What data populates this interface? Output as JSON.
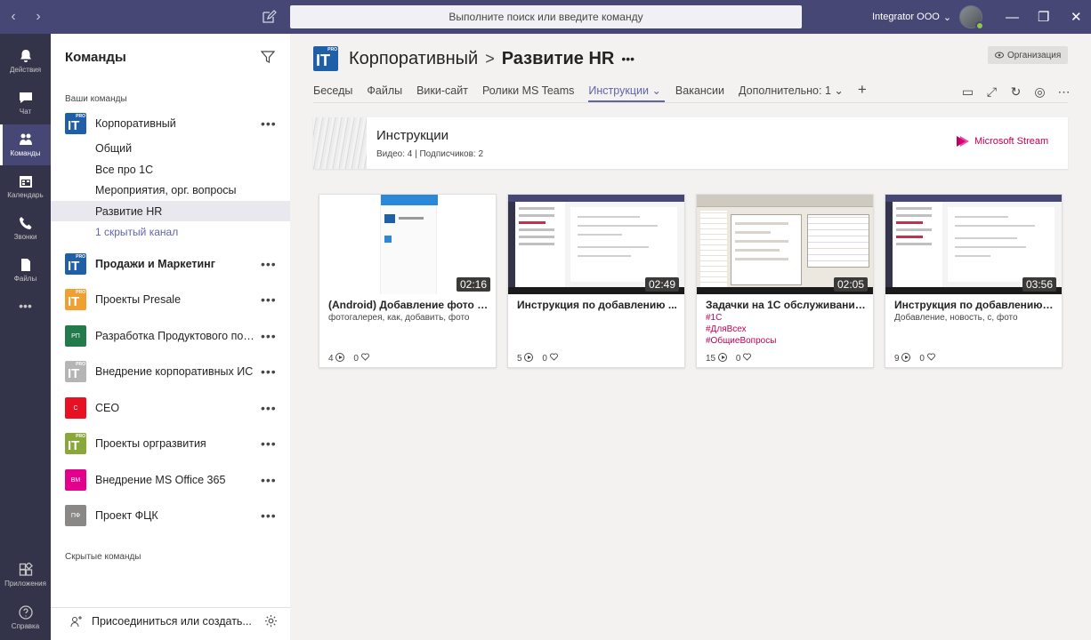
{
  "topbar": {
    "search_placeholder": "Выполните поиск или введите команду",
    "account_name": "Integrator OOO",
    "account_chevron": "⌄"
  },
  "rail": [
    {
      "label": "Действия",
      "icon": "bell-icon"
    },
    {
      "label": "Чат",
      "icon": "chat-icon"
    },
    {
      "label": "Команды",
      "icon": "teams-icon",
      "active": true
    },
    {
      "label": "Календарь",
      "icon": "calendar-icon"
    },
    {
      "label": "Звонки",
      "icon": "phone-icon"
    },
    {
      "label": "Файлы",
      "icon": "files-icon"
    },
    {
      "label": "•••",
      "icon": "more-icon"
    },
    {
      "label": "Приложения",
      "icon": "apps-icon"
    },
    {
      "label": "Справка",
      "icon": "help-icon"
    }
  ],
  "teams_panel": {
    "title": "Команды",
    "your_teams_label": "Ваши команды",
    "hidden_teams_label": "Скрытые команды",
    "join_label": "Присоединиться или создать...",
    "teams": [
      {
        "name": "Корпоративный",
        "logo": "IT",
        "logo_text": "",
        "color": "#1f5fa8",
        "bold": false
      },
      {
        "name": "Продажи и Маркетинг",
        "logo": "IT",
        "logo_text": "",
        "color": "#1f5fa8",
        "bold": true
      },
      {
        "name": "Проекты Presale",
        "logo": "IT-orange",
        "logo_text": "",
        "color": "#f0a030",
        "bold": false
      },
      {
        "name": "Разработка Продуктового пор...",
        "logo": "initials",
        "logo_text": "РП",
        "color": "#237b4b",
        "bold": false
      },
      {
        "name": "Внедрение корпоративных ИС",
        "logo": "IT-gray",
        "logo_text": "",
        "color": "#b5b5b5",
        "bold": false
      },
      {
        "name": "CEO",
        "logo": "initials",
        "logo_text": "C",
        "color": "#e81123",
        "bold": false
      },
      {
        "name": "Проекты оргразвития",
        "logo": "IT-green",
        "logo_text": "",
        "color": "#8aa83a",
        "bold": false
      },
      {
        "name": "Внедрение MS Office 365",
        "logo": "initials",
        "logo_text": "ВМ",
        "color": "#e3008c",
        "bold": false
      },
      {
        "name": "Проект ФЦК",
        "logo": "initials",
        "logo_text": "ПФ",
        "color": "#8a8886",
        "bold": false
      }
    ],
    "channels": [
      "Общий",
      "Все про 1С",
      "Мероприятия, орг. вопросы",
      "Развитие HR"
    ],
    "hidden_channel_link": "1 скрытый канал",
    "dots": "•••"
  },
  "main": {
    "team": "Корпоративный",
    "sep": ">",
    "channel": "Развитие HR",
    "more": "•••",
    "org_label": "Организация",
    "tabs": [
      "Беседы",
      "Файлы",
      "Вики-сайт",
      "Ролики MS Teams",
      "Инструкции",
      "Вакансии",
      "Дополнительно: 1"
    ],
    "active_tab_index": 4,
    "add_tab": "+"
  },
  "stream": {
    "title": "Инструкции",
    "subtitle": "Видео: 4 | Подписчиков: 2",
    "brand": "Microsoft Stream",
    "brand_color": "#c30052"
  },
  "videos": [
    {
      "title": "(Android) Добавление фото в ...",
      "tags": "фотогалерея, как, добавить, фото",
      "hashtags": [],
      "duration": "02:16",
      "views": "4",
      "likes": "0",
      "thumb": "android"
    },
    {
      "title": "Инструкция по добавлению ...",
      "tags": "",
      "hashtags": [],
      "duration": "02:49",
      "views": "5",
      "likes": "0",
      "thumb": "teams"
    },
    {
      "title": "Задачки на 1С обслуживание ...",
      "tags": "",
      "hashtags": [
        "#1С",
        "#ДляВсех",
        "#ОбщиеВопросы"
      ],
      "duration": "02:05",
      "views": "15",
      "likes": "0",
      "thumb": "1c"
    },
    {
      "title": "Инструкция по добавлению н...",
      "tags": "Добавление, новость, с, фото",
      "hashtags": [],
      "duration": "03:56",
      "views": "9",
      "likes": "0",
      "thumb": "teams"
    }
  ]
}
